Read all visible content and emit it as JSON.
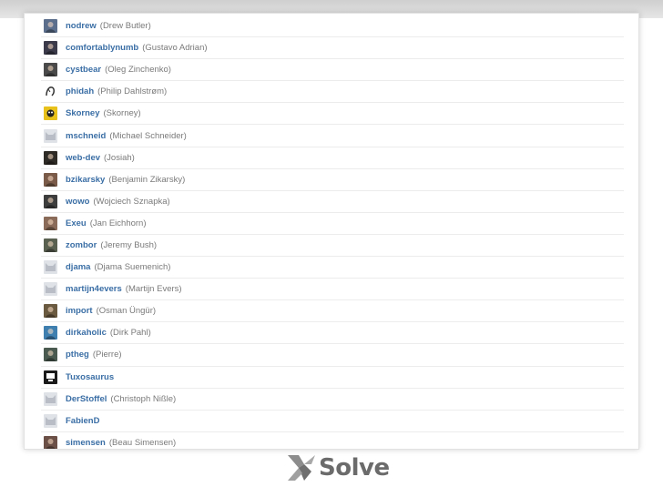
{
  "logo": {
    "text": "Solve"
  },
  "users": [
    {
      "username": "nodrew",
      "realname": "(Drew Butler)",
      "avatar": "photo",
      "color": "#5b6e8c"
    },
    {
      "username": "comfortablynumb",
      "realname": "(Gustavo Adrian)",
      "avatar": "photo",
      "color": "#3a3a4a"
    },
    {
      "username": "cystbear",
      "realname": "(Oleg Zinchenko)",
      "avatar": "photo",
      "color": "#4a4a4a"
    },
    {
      "username": "phidah",
      "realname": "(Philip Dahlstrøm)",
      "avatar": "sketch",
      "color": "#333333"
    },
    {
      "username": "Skorney",
      "realname": "(Skorney)",
      "avatar": "cartoon",
      "color": "#e8c21a"
    },
    {
      "username": "mschneid",
      "realname": "(Michael Schneider)",
      "avatar": "default",
      "color": "#b9bec6"
    },
    {
      "username": "web-dev",
      "realname": "(Josiah)",
      "avatar": "photo",
      "color": "#2e2a26"
    },
    {
      "username": "bzikarsky",
      "realname": "(Benjamin Zikarsky)",
      "avatar": "photo",
      "color": "#7a5a48"
    },
    {
      "username": "wowo",
      "realname": "(Wojciech Sznapka)",
      "avatar": "photo",
      "color": "#3d3d3d"
    },
    {
      "username": "Exeu",
      "realname": "(Jan Eichhorn)",
      "avatar": "photo",
      "color": "#8a6a58"
    },
    {
      "username": "zombor",
      "realname": "(Jeremy Bush)",
      "avatar": "photo",
      "color": "#5a6050"
    },
    {
      "username": "djama",
      "realname": "(Djama Suemenich)",
      "avatar": "default",
      "color": "#b9bec6"
    },
    {
      "username": "martijn4evers",
      "realname": "(Martijn Evers)",
      "avatar": "default",
      "color": "#b9bec6"
    },
    {
      "username": "import",
      "realname": "(Osman Üngür)",
      "avatar": "photo",
      "color": "#6a5a40"
    },
    {
      "username": "dirkaholic",
      "realname": "(Dirk Pahl)",
      "avatar": "photo",
      "color": "#3f7fb0"
    },
    {
      "username": "ptheg",
      "realname": "(Pierre)",
      "avatar": "photo",
      "color": "#4a5a50"
    },
    {
      "username": "Tuxosaurus",
      "realname": "",
      "avatar": "icon",
      "color": "#1a1a1a"
    },
    {
      "username": "DerStoffel",
      "realname": "(Christoph Nißle)",
      "avatar": "default",
      "color": "#b9bec6"
    },
    {
      "username": "FabienD",
      "realname": "",
      "avatar": "default",
      "color": "#b9bec6"
    },
    {
      "username": "simensen",
      "realname": "(Beau Simensen)",
      "avatar": "photo",
      "color": "#6a5046"
    }
  ]
}
